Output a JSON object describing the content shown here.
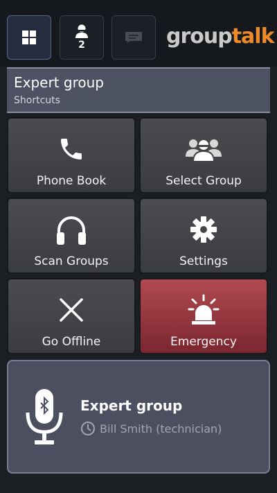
{
  "tabs": {
    "shortcuts": {
      "icon": "grid-icon"
    },
    "contacts": {
      "icon": "person-icon",
      "badge": "2"
    },
    "messages": {
      "icon": "message-icon"
    }
  },
  "logo": {
    "part1": "group",
    "part2": "talk"
  },
  "header": {
    "title": "Expert group",
    "subtitle": "Shortcuts"
  },
  "tiles": [
    {
      "label": "Phone Book",
      "icon": "phone-icon"
    },
    {
      "label": "Select Group",
      "icon": "group-icon"
    },
    {
      "label": "Scan Groups",
      "icon": "headphones-icon"
    },
    {
      "label": "Settings",
      "icon": "gear-icon"
    },
    {
      "label": "Go Offline",
      "icon": "close-icon"
    },
    {
      "label": "Emergency",
      "icon": "siren-icon"
    }
  ],
  "ptt": {
    "group": "Expert group",
    "last_speaker": "Bill Smith (technician)",
    "icon": "bluetooth-microphone-icon"
  },
  "colors": {
    "accent": "#ee8a2a",
    "emergency": "#9a3a42",
    "header": "#4d5263"
  }
}
